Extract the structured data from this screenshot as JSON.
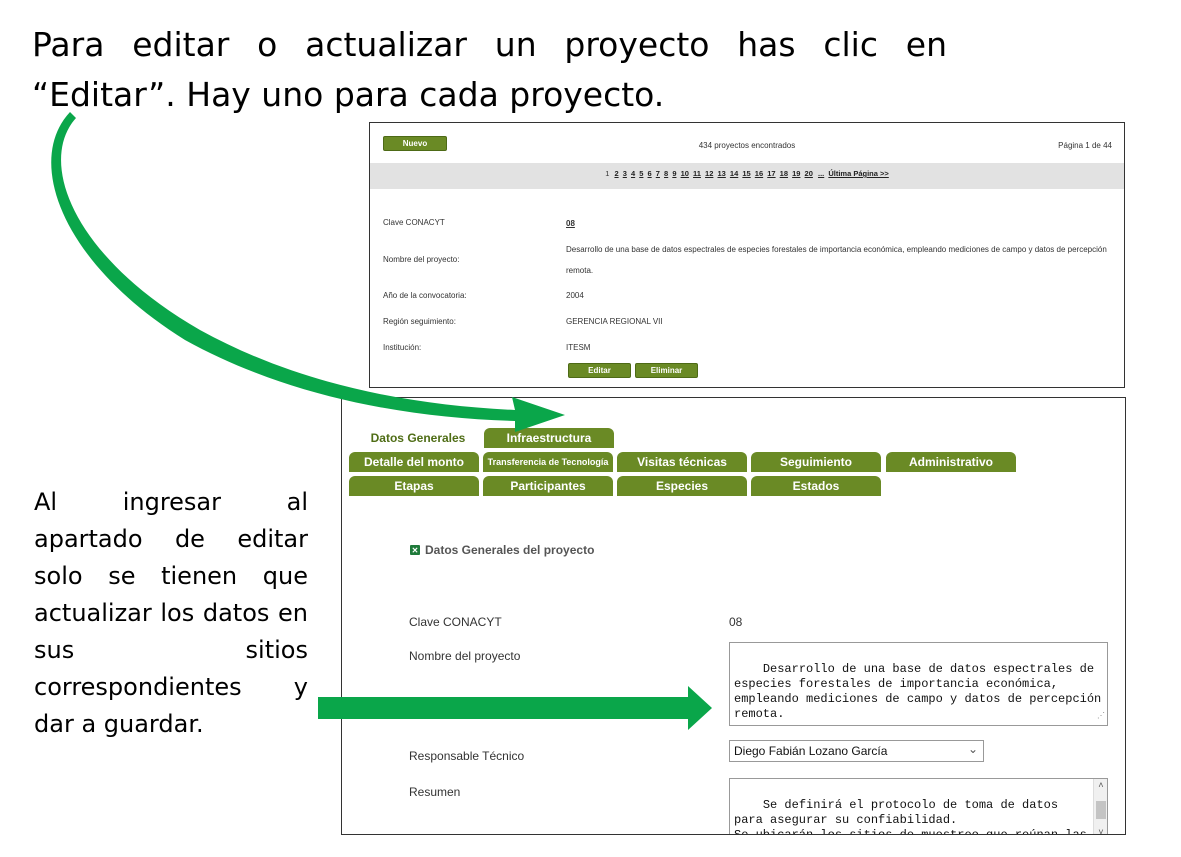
{
  "instructions": {
    "title": "Para editar o actualizar un proyecto has clic en “Editar”. Hay uno para cada proyecto.",
    "side_text": "Al ingresar al apartado de editar solo se tienen que actualizar los datos en sus sitios correspondientes y dar a guardar."
  },
  "list_view": {
    "new_button": "Nuevo",
    "results_count": "434 proyectos encontrados",
    "page_indicator": "Página 1 de 44",
    "pager_current": "1",
    "pager_links": [
      "2",
      "3",
      "4",
      "5",
      "6",
      "7",
      "8",
      "9",
      "10",
      "11",
      "12",
      "13",
      "14",
      "15",
      "16",
      "17",
      "18",
      "19",
      "20"
    ],
    "pager_ellipsis": "...",
    "pager_last": "Última Página >>",
    "fields": [
      {
        "label": "Clave CONACYT",
        "value": "08"
      },
      {
        "label": "Nombre del proyecto:",
        "value": "Desarrollo de una base de datos espectrales de especies forestales de importancia económica, empleando mediciones de campo y datos de percepción remota."
      },
      {
        "label": "Año de la convocatoria:",
        "value": "2004"
      },
      {
        "label": "Región seguimiento:",
        "value": "GERENCIA REGIONAL VII"
      },
      {
        "label": "Institución:",
        "value": "ITESM"
      }
    ],
    "edit_button": "Editar",
    "delete_button": "Eliminar"
  },
  "edit_view": {
    "tabs_row1": [
      "Datos Generales",
      "Infraestructura"
    ],
    "tabs_row2": [
      "Detalle  del monto",
      "Transferencia de Tecnología",
      "Visitas técnicas",
      "Seguimiento",
      "Administrativo"
    ],
    "tabs_row3": [
      "Etapas",
      "Participantes",
      "Especies",
      "Estados"
    ],
    "section_title": "Datos Generales del proyecto",
    "clave_label": "Clave CONACYT",
    "clave_value": "08",
    "nombre_label": "Nombre del proyecto",
    "nombre_value": "Desarrollo de una base de datos espectrales de especies forestales de importancia económica, empleando mediciones de campo y datos de percepción remota.",
    "responsable_label": "Responsable Técnico",
    "responsable_value": "Diego Fabián Lozano García",
    "resumen_label": "Resumen",
    "resumen_value": "Se definirá el protocolo de toma de datos para asegurar su confiabilidad.\nSe ubicarán los sitios de muestreo que reúnan las características necesarias para"
  },
  "colors": {
    "accent_green": "#6a8a25",
    "arrow_green": "#0aa64a"
  }
}
